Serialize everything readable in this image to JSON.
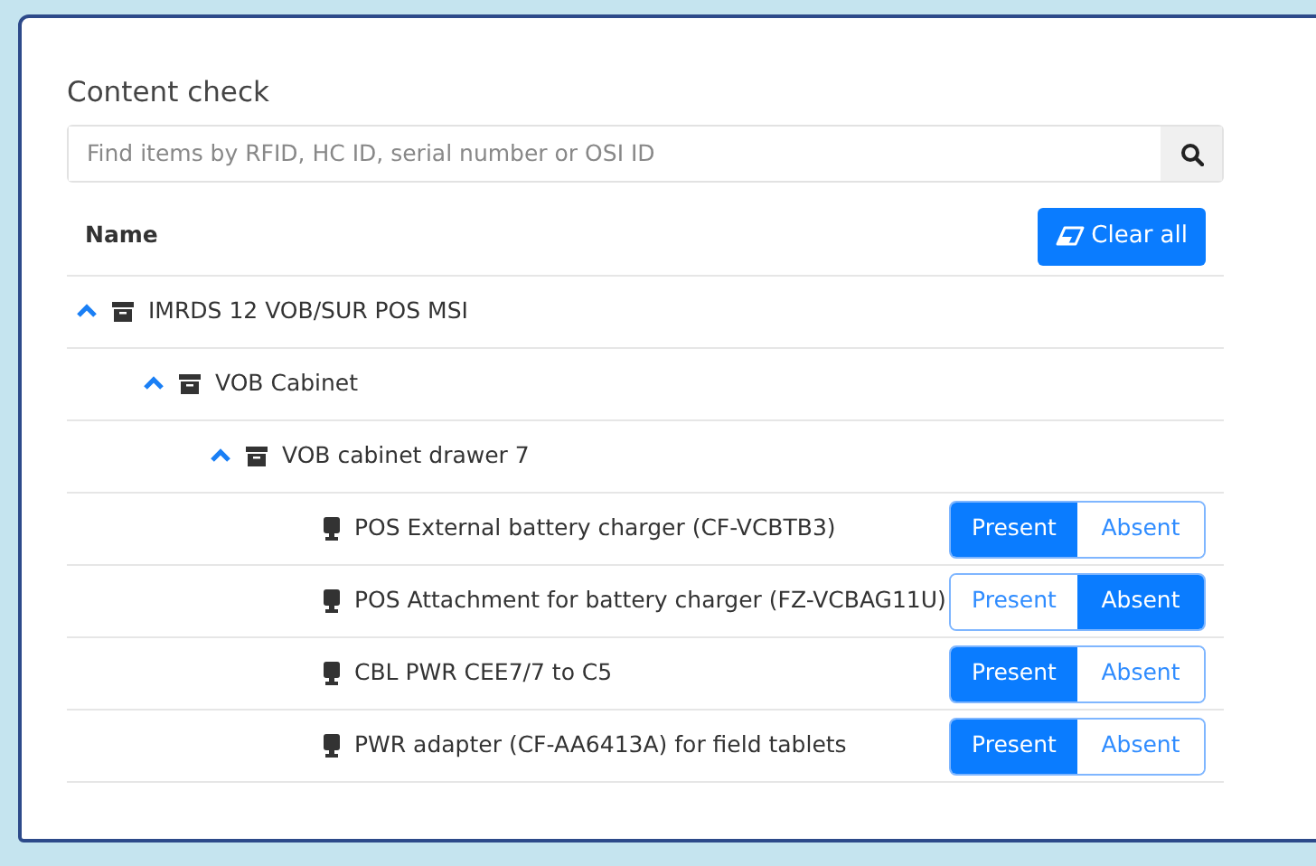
{
  "title": "Content check",
  "search": {
    "placeholder": "Find items by RFID, HC ID, serial number or OSI ID"
  },
  "header": {
    "column": "Name",
    "clear_button": "Clear all"
  },
  "tree": [
    {
      "kind": "container",
      "label": "IMRDS 12 VOB/SUR POS MSI",
      "expanded": true,
      "children": [
        {
          "kind": "container",
          "label": "VOB Cabinet",
          "expanded": true,
          "children": [
            {
              "kind": "container",
              "label": "VOB cabinet drawer 7",
              "expanded": true,
              "children": [
                {
                  "kind": "item",
                  "label": "POS External battery charger (CF-VCBTB3)",
                  "options": [
                    {
                      "label": "Present",
                      "selected": true
                    },
                    {
                      "label": "Absent",
                      "selected": false
                    }
                  ]
                },
                {
                  "kind": "item",
                  "label": "POS Attachment for battery charger (FZ-VCBAG11U)",
                  "options": [
                    {
                      "label": "Present",
                      "selected": false
                    },
                    {
                      "label": "Absent",
                      "selected": true
                    }
                  ]
                },
                {
                  "kind": "item",
                  "label": "CBL PWR CEE7/7 to C5",
                  "options": [
                    {
                      "label": "Present",
                      "selected": true
                    },
                    {
                      "label": "Absent",
                      "selected": false
                    }
                  ]
                },
                {
                  "kind": "item",
                  "label": "PWR adapter (CF-AA6413A) for field tablets",
                  "options": [
                    {
                      "label": "Present",
                      "selected": true
                    },
                    {
                      "label": "Absent",
                      "selected": false
                    }
                  ]
                }
              ]
            }
          ]
        }
      ]
    }
  ]
}
